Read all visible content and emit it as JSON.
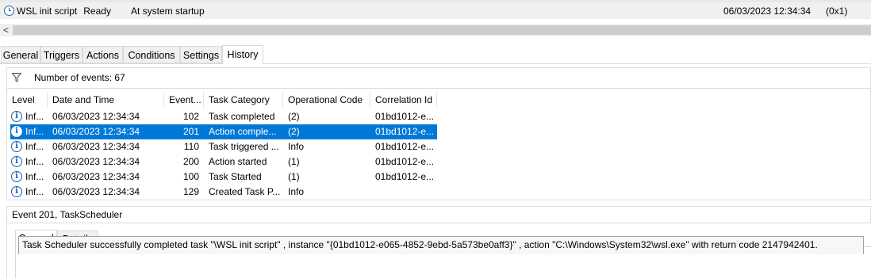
{
  "task": {
    "name": "WSL init script",
    "status": "Ready",
    "trigger": "At system startup",
    "last_run_time": "06/03/2023 12:34:34",
    "last_run_result": "(0x1)",
    "icon": "clock-icon"
  },
  "scrollbar": {
    "left_arrow": "<"
  },
  "tabs": [
    {
      "label": "General"
    },
    {
      "label": "Triggers"
    },
    {
      "label": "Actions"
    },
    {
      "label": "Conditions"
    },
    {
      "label": "Settings"
    },
    {
      "label": "History"
    }
  ],
  "history": {
    "filter_icon": "filter-icon",
    "event_count": "Number of events: 67",
    "columns": [
      "Level",
      "Date and Time",
      "Event...",
      "Task Category",
      "Operational Code",
      "Correlation Id"
    ],
    "rows": [
      {
        "level": "Inf...",
        "date": "06/03/2023 12:34:34",
        "event": "102",
        "category": "Task completed",
        "opcode": "(2)",
        "correlation": "01bd1012-e..."
      },
      {
        "level": "Inf...",
        "date": "06/03/2023 12:34:34",
        "event": "201",
        "category": "Action comple...",
        "opcode": "(2)",
        "correlation": "01bd1012-e..."
      },
      {
        "level": "Inf...",
        "date": "06/03/2023 12:34:34",
        "event": "110",
        "category": "Task triggered ...",
        "opcode": "Info",
        "correlation": "01bd1012-e..."
      },
      {
        "level": "Inf...",
        "date": "06/03/2023 12:34:34",
        "event": "200",
        "category": "Action started",
        "opcode": "(1)",
        "correlation": "01bd1012-e..."
      },
      {
        "level": "Inf...",
        "date": "06/03/2023 12:34:34",
        "event": "100",
        "category": "Task Started",
        "opcode": "(1)",
        "correlation": "01bd1012-e..."
      },
      {
        "level": "Inf...",
        "date": "06/03/2023 12:34:34",
        "event": "129",
        "category": "Created Task P...",
        "opcode": "Info",
        "correlation": ""
      }
    ]
  },
  "detail": {
    "title": "Event 201, TaskScheduler",
    "tabs": [
      {
        "label": "General"
      },
      {
        "label": "Details"
      }
    ],
    "message": "Task Scheduler successfully completed task \"\\WSL init script\" , instance \"{01bd1012-e065-4852-9ebd-5a573be0aff3}\" , action \"C:\\Windows\\System32\\wsl.exe\" with return code 2147942401."
  },
  "colors": {
    "selection": "#0078d7",
    "info_icon": "#1e5eb5"
  }
}
